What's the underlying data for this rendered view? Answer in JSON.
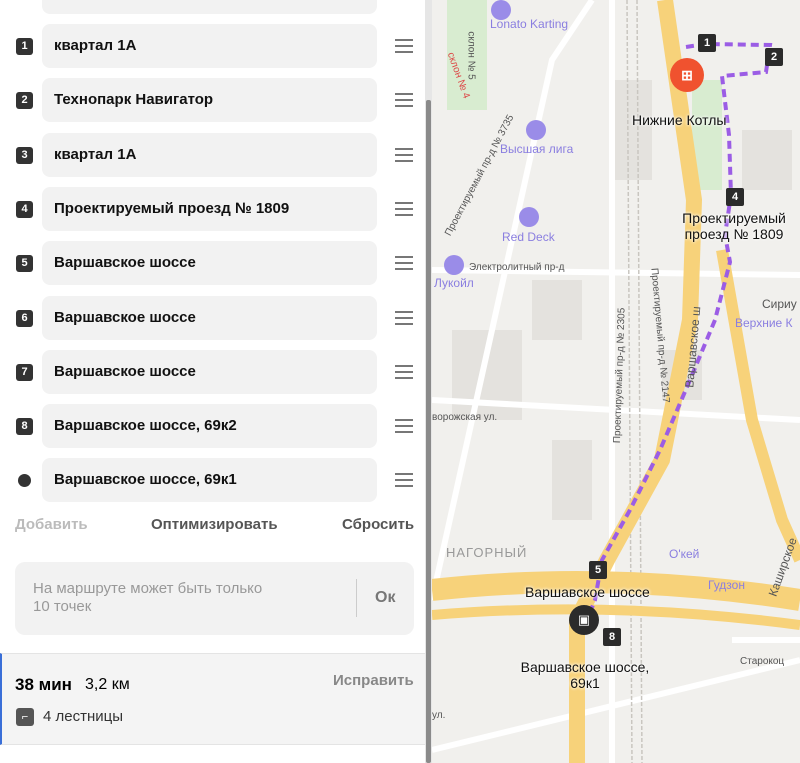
{
  "waypoints": [
    {
      "number": "1",
      "label": "квартал 1А"
    },
    {
      "number": "2",
      "label": "Технопарк Навигатор"
    },
    {
      "number": "3",
      "label": "квартал 1А"
    },
    {
      "number": "4",
      "label": "Проектируемый проезд № 1809"
    },
    {
      "number": "5",
      "label": "Варшавское шоссе"
    },
    {
      "number": "6",
      "label": "Варшавское шоссе"
    },
    {
      "number": "7",
      "label": "Варшавское шоссе"
    },
    {
      "number": "8",
      "label": "Варшавское шоссе, 69к2"
    },
    {
      "number": "",
      "label": "Варшавское шоссе, 69к1"
    }
  ],
  "actions": {
    "add": "Добавить",
    "optimize": "Оптимизировать",
    "reset": "Сбросить"
  },
  "notice": {
    "text": "На маршруте может быть только 10 точек",
    "ok": "Ок"
  },
  "summary": {
    "duration": "38 мин",
    "distance": "3,2 км",
    "fix": "Исправить",
    "stairs": "4 лестницы"
  },
  "map": {
    "labels": {
      "nizhnie": "Нижние Котлы",
      "proezd": "Проектируемый проезд № 1809",
      "varsh": "Варшавское шоссе",
      "varsh69": "Варшавское шоссе, 69к1"
    },
    "markers": [
      "1",
      "2",
      "4",
      "5",
      "8"
    ],
    "pois": {
      "lonato": "Lonato Karting",
      "vysshaya": "Высшая лига",
      "reddeck": "Red Deck",
      "lukoil": "Лукойл",
      "okey": "О'кей",
      "gudzon": "Гудзон",
      "siriu": "Сириу",
      "verkhnie": "Верхние К"
    },
    "streets": {
      "pr3735": "Проектируемый пр-д № 3735",
      "elektro": "Электролитный пр-д",
      "pr2305": "Проектируемый пр-д № 2305",
      "pr2147": "Проектируемый пр-д № 2147",
      "dvor": "ворожская ул.",
      "nagorny": "НАГОРНЫЙ",
      "varshsh": "Варшавское ш",
      "kashir": "Каширское",
      "starok": "Старокоц",
      "sklon5": "склон № 5",
      "sklon4": "склон № 4",
      "ul": "ул."
    },
    "route_color": "#9b5de5"
  }
}
